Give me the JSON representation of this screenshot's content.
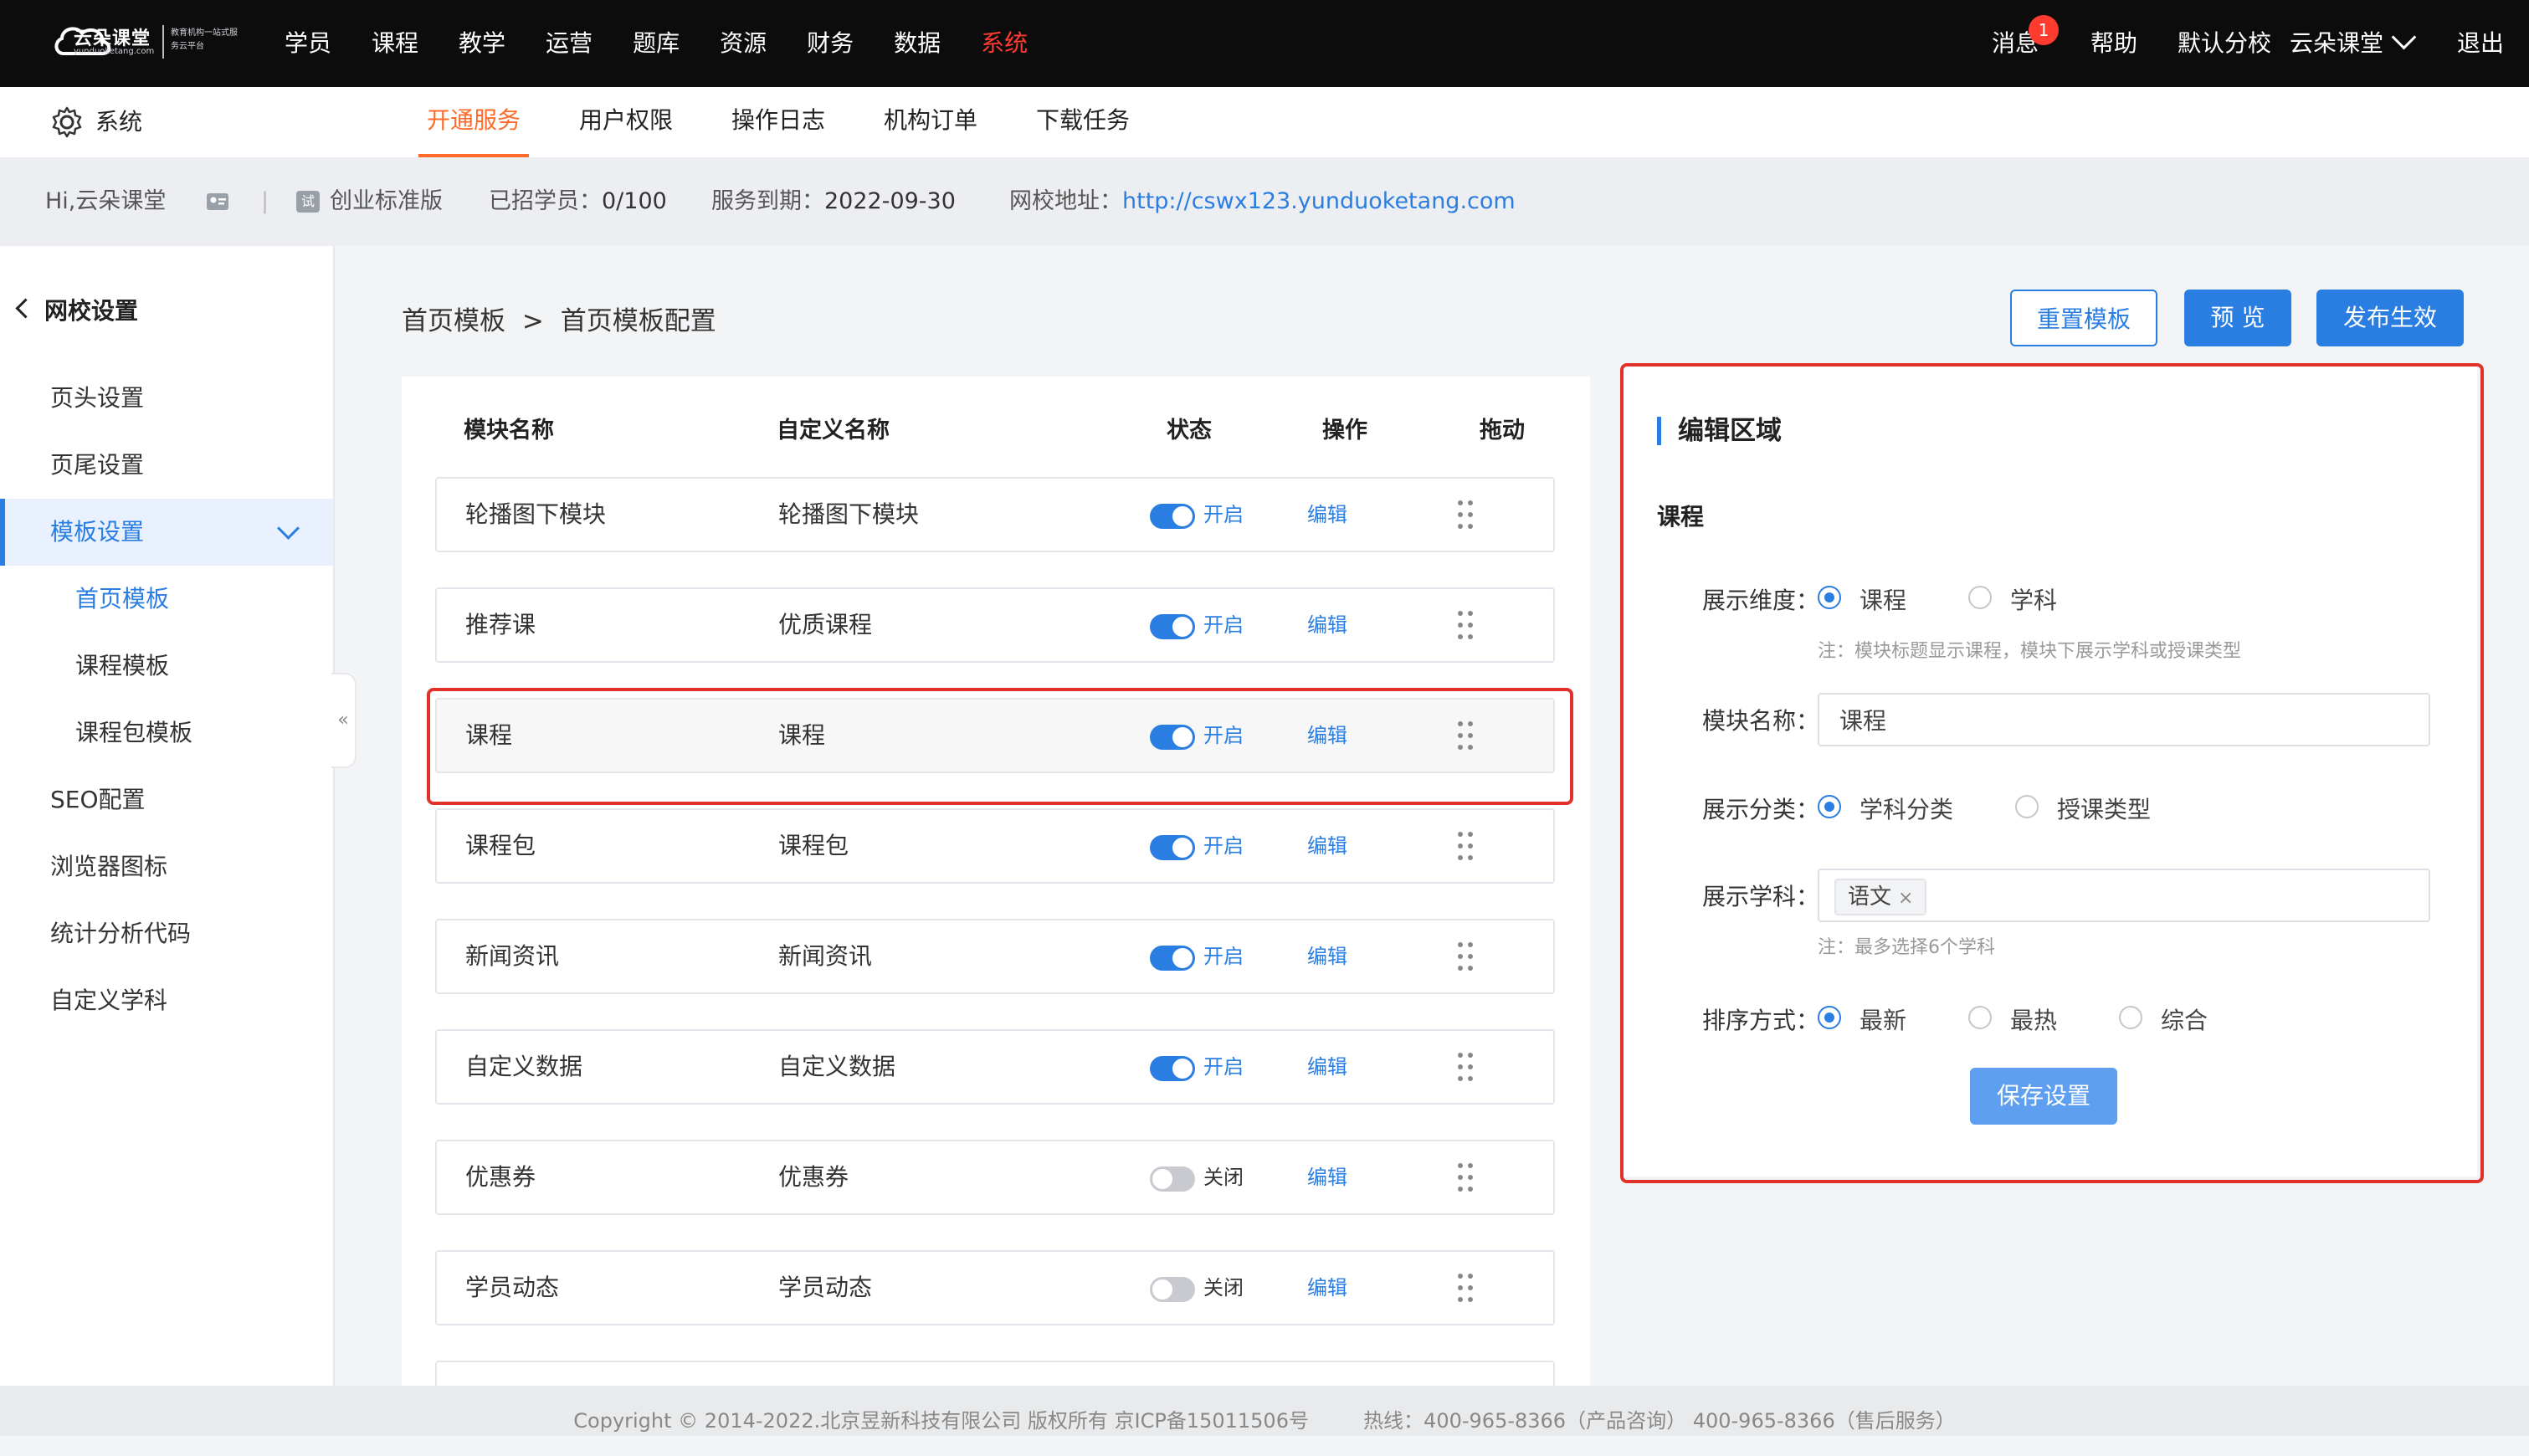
{
  "logo": {
    "name": "云朵课堂",
    "domain": "yunduoketang.com",
    "slogan": "教育机构一站式服务云平台"
  },
  "topnav": [
    "学员",
    "课程",
    "教学",
    "运营",
    "题库",
    "资源",
    "财务",
    "数据",
    "系统"
  ],
  "topright": {
    "messages": "消息",
    "message_count": "1",
    "help": "帮助",
    "branch": "默认分校",
    "school": "云朵课堂",
    "logout": "退出"
  },
  "subbar": {
    "section": "系统",
    "tabs": [
      "开通服务",
      "用户权限",
      "操作日志",
      "机构订单",
      "下载任务"
    ]
  },
  "infobar": {
    "greeting": "Hi,云朵课堂",
    "edition_badge": "试",
    "edition": "创业标准版",
    "students_label": "已招学员：",
    "students_value": "0/100",
    "expire_label": "服务到期：",
    "expire_value": "2022-09-30",
    "url_label": "网校地址：",
    "url_value": "http://cswx123.yunduoketang.com"
  },
  "sidebar": {
    "back": "网校设置",
    "items": [
      "页头设置",
      "页尾设置",
      "模板设置",
      "首页模板",
      "课程模板",
      "课程包模板",
      "SEO配置",
      "浏览器图标",
      "统计分析代码",
      "自定义学科"
    ],
    "collapse": "«"
  },
  "breadcrumb": {
    "parent": "首页模板",
    "sep": ">",
    "current": "首页模板配置"
  },
  "actions": {
    "reset": "重置模板",
    "preview": "预 览",
    "publish": "发布生效"
  },
  "table": {
    "headers": [
      "模块名称",
      "自定义名称",
      "状态",
      "操作",
      "拖动"
    ],
    "rows": [
      {
        "module": "轮播图下模块",
        "custom": "轮播图下模块",
        "status": "开启",
        "on": true,
        "action": "编辑"
      },
      {
        "module": "推荐课",
        "custom": "优质课程",
        "status": "开启",
        "on": true,
        "action": "编辑"
      },
      {
        "module": "课程",
        "custom": "课程",
        "status": "开启",
        "on": true,
        "action": "编辑"
      },
      {
        "module": "课程包",
        "custom": "课程包",
        "status": "开启",
        "on": true,
        "action": "编辑"
      },
      {
        "module": "新闻资讯",
        "custom": "新闻资讯",
        "status": "开启",
        "on": true,
        "action": "编辑"
      },
      {
        "module": "自定义数据",
        "custom": "自定义数据",
        "status": "开启",
        "on": true,
        "action": "编辑"
      },
      {
        "module": "优惠券",
        "custom": "优惠券",
        "status": "关闭",
        "on": false,
        "action": "编辑"
      },
      {
        "module": "学员动态",
        "custom": "学员动态",
        "status": "关闭",
        "on": false,
        "action": "编辑"
      }
    ]
  },
  "panel": {
    "title": "编辑区域",
    "subtitle": "课程",
    "dimension_label": "展示维度：",
    "dimension_options": [
      "课程",
      "学科"
    ],
    "dimension_note": "注：模块标题显示课程，模块下展示学科或授课类型",
    "name_label": "模块名称：",
    "name_value": "课程",
    "category_label": "展示分类：",
    "category_options": [
      "学科分类",
      "授课类型"
    ],
    "subject_label": "展示学科：",
    "subject_tag": "语文",
    "subject_tag_remove": "×",
    "subject_note": "注：最多选择6个学科",
    "sort_label": "排序方式：",
    "sort_options": [
      "最新",
      "最热",
      "综合"
    ],
    "save": "保存设置"
  },
  "footer": {
    "copyright": "Copyright © 2014-2022.北京昱新科技有限公司 版权所有 京ICP备15011506号",
    "hotline": "热线：400-965-8366（产品咨询） 400-965-8366（售后服务）"
  },
  "colors": {
    "accent": "#2a7de1",
    "active_nav": "#ff3b30",
    "active_tab": "#ff6a2b",
    "highlight_box": "#e0322b"
  }
}
